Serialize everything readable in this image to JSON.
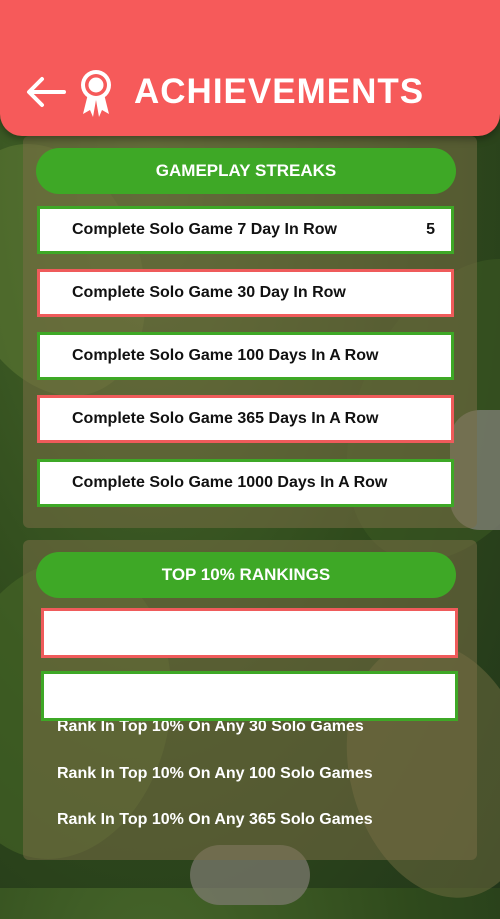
{
  "header": {
    "title": "ACHIEVEMENTS",
    "back_icon": "arrow-left-icon",
    "award_icon": "award-ribbon-icon",
    "background_color": "#f65a5a"
  },
  "streaks": {
    "title": "GAMEPLAY STREAKS",
    "items": [
      {
        "label": "Complete Solo Game 7 Day In Row",
        "count": "5",
        "status": "green"
      },
      {
        "label": "Complete Solo Game 30 Day In Row",
        "count": "",
        "status": "red"
      },
      {
        "label": "Complete Solo Game 100 Days In A Row",
        "count": "",
        "status": "green"
      },
      {
        "label": "Complete Solo Game 365 Days In A Row",
        "count": "",
        "status": "red"
      },
      {
        "label": "Complete Solo Game 1000 Days In A Row",
        "count": "",
        "status": "green"
      }
    ]
  },
  "rankings": {
    "title": "TOP 10% RANKINGS",
    "items": [
      {
        "label": "Rank In Top 10% On Any 30 Solo Games"
      },
      {
        "label": "Rank In Top 10% On Any 100 Solo Games"
      },
      {
        "label": "Rank In Top 10% On Any 365 Solo Games"
      }
    ]
  },
  "colors": {
    "accent_green": "#3ea826",
    "accent_red": "#ef5b5b"
  }
}
